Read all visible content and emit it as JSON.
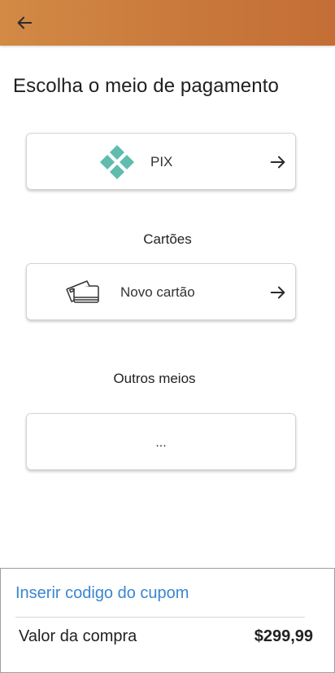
{
  "header": {
    "back_icon": "arrow-left-icon",
    "brand_color": "#c97a3d"
  },
  "page": {
    "title": "Escolha o meio de pagamento"
  },
  "methods": {
    "pix": {
      "label": "PIX",
      "icon": "pix-logo-icon",
      "icon_color": "#5fbcae",
      "arrow_icon": "arrow-right-icon"
    },
    "cards_section": {
      "title": "Cartões",
      "new_card": {
        "label": "Novo cartão",
        "icon": "credit-card-icon",
        "arrow_icon": "arrow-right-icon"
      }
    },
    "other_section": {
      "title": "Outros meios",
      "placeholder": "..."
    }
  },
  "footer": {
    "coupon_link": "Inserir codigo do cupom",
    "coupon_color": "#3a86d0",
    "total_label": "Valor da compra",
    "total_value": "$299,99"
  }
}
